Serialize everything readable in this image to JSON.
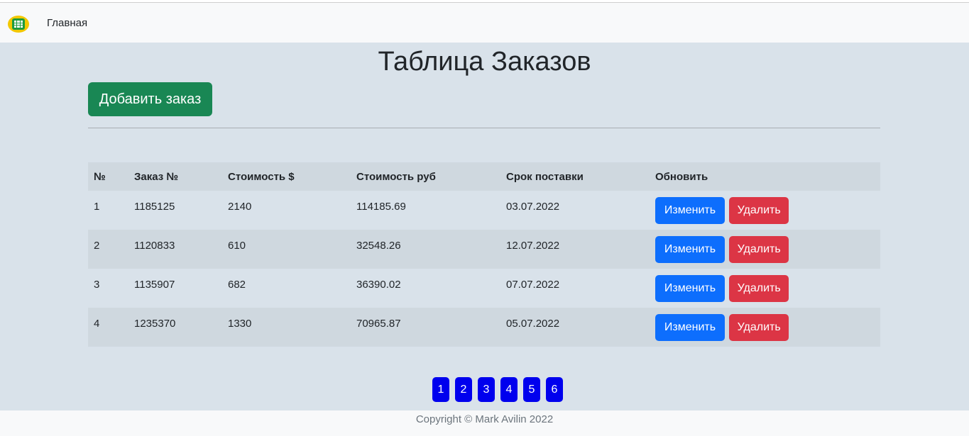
{
  "navbar": {
    "logo_icon": "spreadsheet-icon",
    "home_label": "Главная"
  },
  "page": {
    "title": "Таблица Заказов",
    "add_button_label": "Добавить заказ"
  },
  "table": {
    "headers": [
      "№",
      "Заказ №",
      "Стоимость $",
      "Стоимость руб",
      "Срок поставки",
      "Обновить"
    ],
    "rows": [
      {
        "num": "1",
        "order": "1185125",
        "usd": "2140",
        "rub": "114185.69",
        "date": "03.07.2022"
      },
      {
        "num": "2",
        "order": "1120833",
        "usd": "610",
        "rub": "32548.26",
        "date": "12.07.2022"
      },
      {
        "num": "3",
        "order": "1135907",
        "usd": "682",
        "rub": "36390.02",
        "date": "07.07.2022"
      },
      {
        "num": "4",
        "order": "1235370",
        "usd": "1330",
        "rub": "70965.87",
        "date": "05.07.2022"
      }
    ],
    "edit_label": "Изменить",
    "delete_label": "Удалить"
  },
  "pagination": {
    "pages": [
      "1",
      "2",
      "3",
      "4",
      "5",
      "6"
    ]
  },
  "footer": {
    "copyright": "Copyright © Mark Avilin 2022"
  },
  "colors": {
    "background": "#d9e2ea",
    "navbar": "#f8f9fa",
    "add_button": "#198754",
    "edit_button": "#0d6efd",
    "delete_button": "#dc3545",
    "page_button": "#0000ee"
  }
}
